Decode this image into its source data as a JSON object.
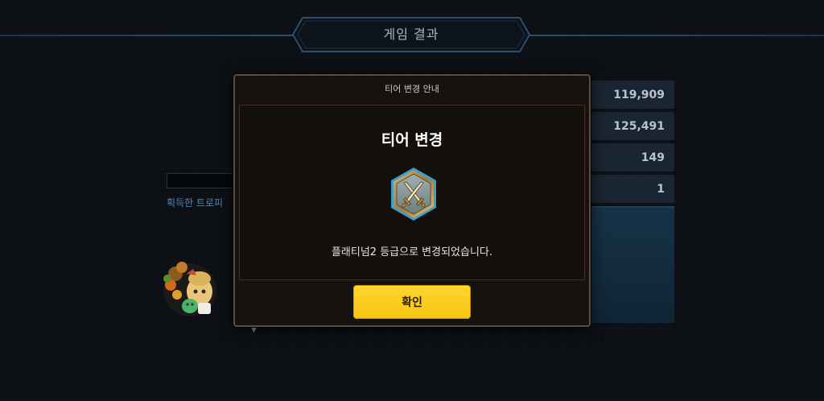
{
  "header": {
    "title": "게임 결과"
  },
  "background": {
    "scores": [
      "119,909",
      "125,491",
      "149",
      "1"
    ],
    "trophy_label": "획득한 트로피",
    "arrow": "▼"
  },
  "modal": {
    "title": "티어 변경 안내",
    "heading": "티어 변경",
    "message": "플래티넘2 등급으로 변경되었습니다.",
    "confirm_label": "확인",
    "badge_icon": "platinum-tier-crossed-swords-icon"
  },
  "colors": {
    "accent_button": "#ffd42e",
    "header_line": "#2c4f70",
    "modal_border": "#5a4e3e"
  }
}
